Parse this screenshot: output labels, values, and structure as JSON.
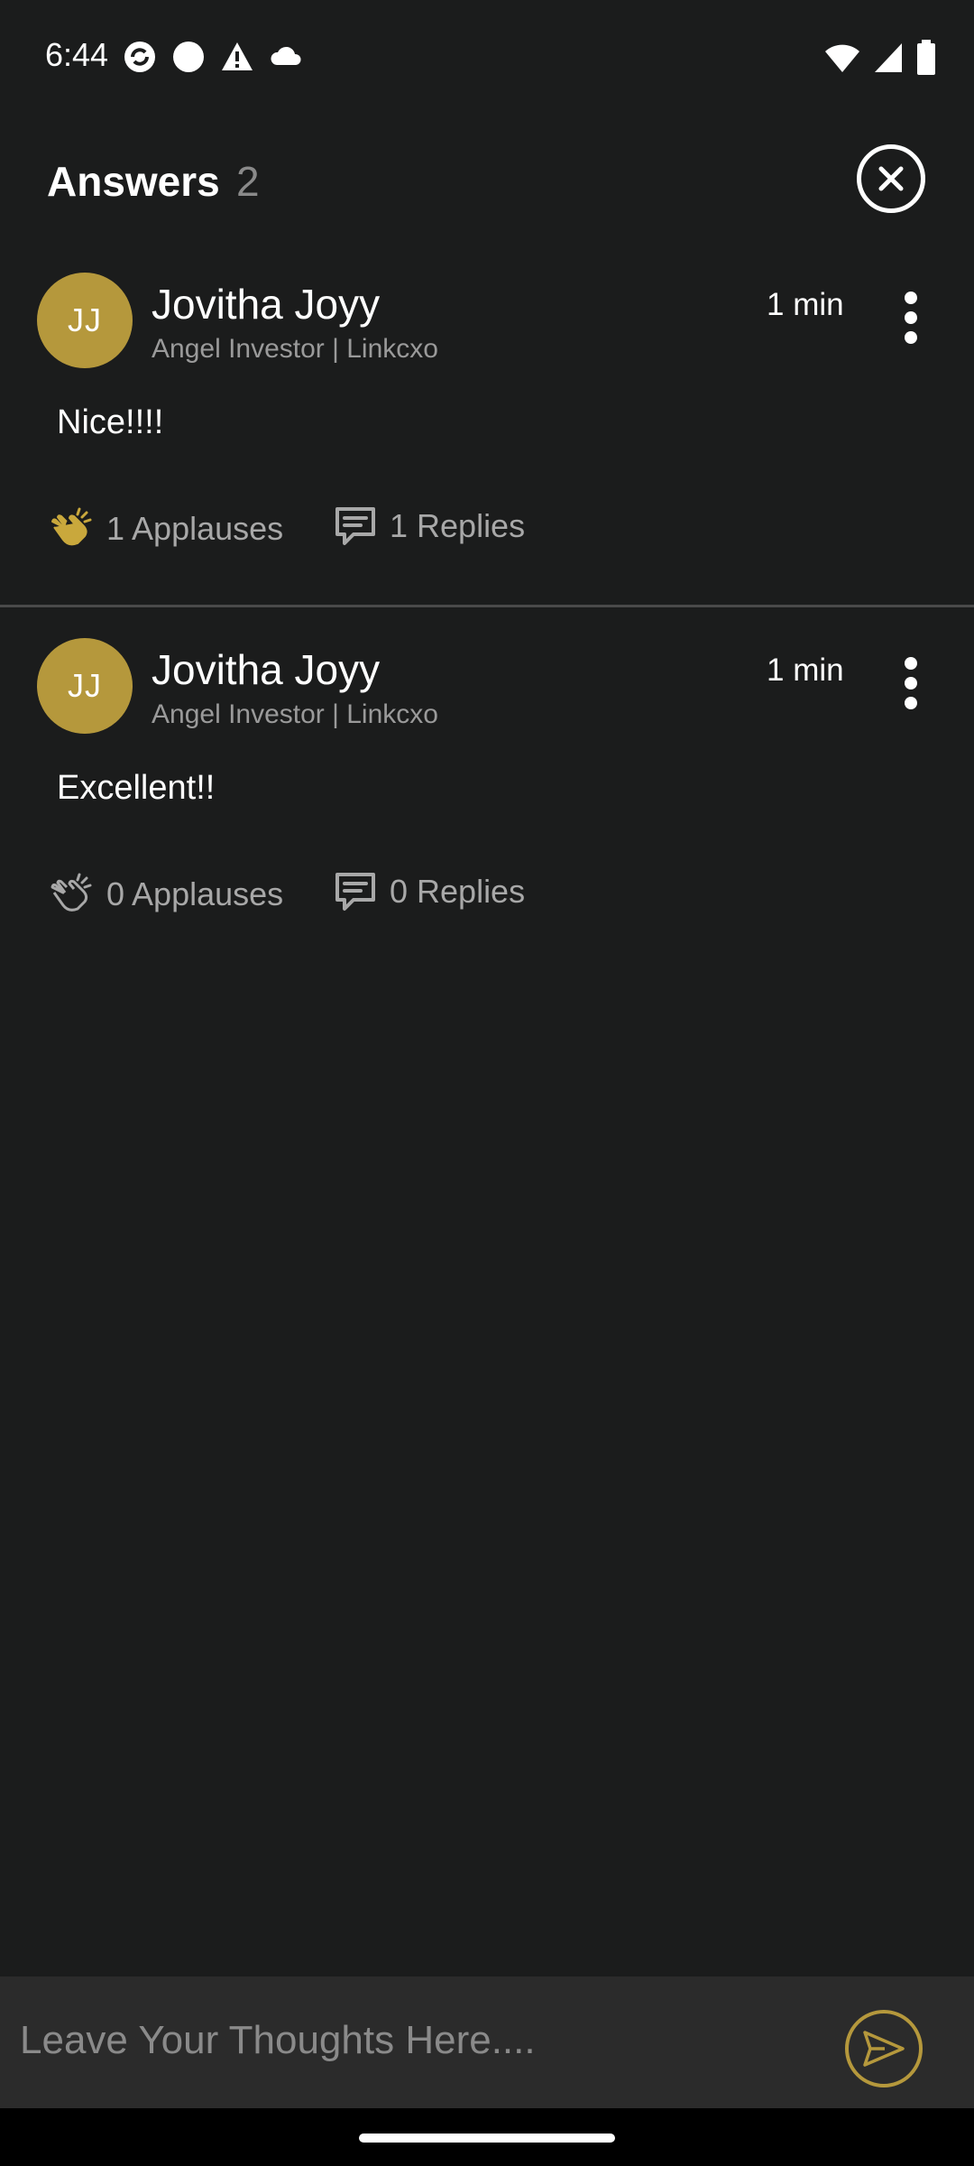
{
  "status_bar": {
    "time": "6:44",
    "left_icons": [
      "sync-icon",
      "circle-icon",
      "warning-icon",
      "cloud-icon"
    ],
    "right_icons": [
      "wifi-icon",
      "signal-icon",
      "battery-icon"
    ]
  },
  "header": {
    "title": "Answers",
    "count": "2"
  },
  "answers": [
    {
      "initials": "JJ",
      "name": "Jovitha Joyy",
      "subtitle": "Angel Investor | Linkcxo",
      "time": "1 min",
      "text": "Nice!!!!",
      "applauses": "1 Applauses",
      "replies": "1 Replies",
      "applauded": true
    },
    {
      "initials": "JJ",
      "name": "Jovitha Joyy",
      "subtitle": "Angel Investor | Linkcxo",
      "time": "1 min",
      "text": "Excellent!!",
      "applauses": "0 Applauses",
      "replies": "0 Replies",
      "applauded": false
    }
  ],
  "comment_box": {
    "placeholder": "Leave Your Thoughts Here...."
  },
  "colors": {
    "background": "#1b1c1c",
    "accent": "#b5983c",
    "muted_text": "#a8a8a8"
  }
}
